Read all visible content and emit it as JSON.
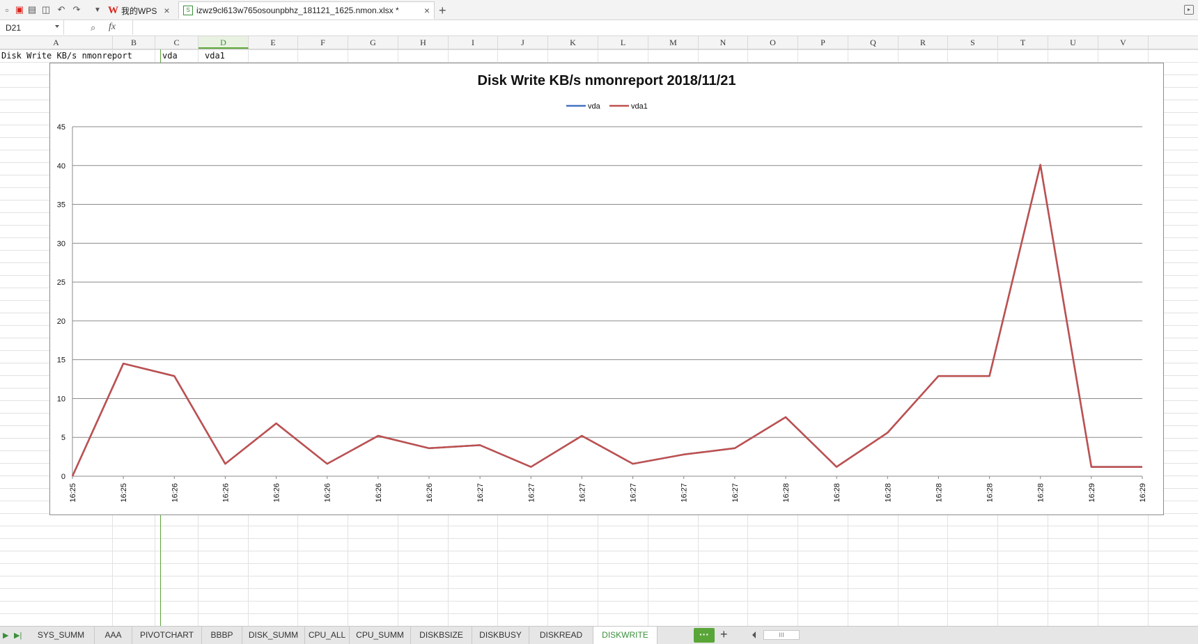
{
  "toolbar": {
    "wps_tab_label": "我的WPS",
    "file_tab_label": "izwz9cl613w765osounpbhz_181121_1625.nmon.xlsx *",
    "close_glyph": "×",
    "add_glyph": "+"
  },
  "formula_bar": {
    "name_box": "D21",
    "fx_label": "fx"
  },
  "columns": [
    "A",
    "B",
    "C",
    "D",
    "E",
    "F",
    "G",
    "H",
    "I",
    "J",
    "K",
    "L",
    "M",
    "N",
    "O",
    "P",
    "Q",
    "R",
    "S",
    "T",
    "U",
    "V"
  ],
  "selected_column": "D",
  "row1": {
    "a": "Disk Write KB/s nmonreport",
    "b": "vda",
    "c": "vda1"
  },
  "chart_data": {
    "type": "line",
    "title": "Disk Write KB/s nmonreport  2018/11/21",
    "xlabel": "",
    "ylabel": "",
    "ylim": [
      0,
      45
    ],
    "yticks": [
      0,
      5,
      10,
      15,
      20,
      25,
      30,
      35,
      40,
      45
    ],
    "legend_position": "top",
    "grid": true,
    "x": [
      "16:25",
      "16:25",
      "16:26",
      "16:26",
      "16:26",
      "16:26",
      "16:26",
      "16:26",
      "16:27",
      "16:27",
      "16:27",
      "16:27",
      "16:27",
      "16:27",
      "16:28",
      "16:28",
      "16:28",
      "16:28",
      "16:28",
      "16:28",
      "16:29",
      "16:29"
    ],
    "series": [
      {
        "name": "vda",
        "color": "#4472c4",
        "values": [
          0,
          14.5,
          12.9,
          1.6,
          6.8,
          1.6,
          5.2,
          3.6,
          4.0,
          1.2,
          5.2,
          1.6,
          2.8,
          3.6,
          7.6,
          1.2,
          5.6,
          12.9,
          12.9,
          40.1,
          1.2,
          1.2
        ]
      },
      {
        "name": "vda1",
        "color": "#c0504d",
        "values": [
          0,
          14.5,
          12.9,
          1.6,
          6.8,
          1.6,
          5.2,
          3.6,
          4.0,
          1.2,
          5.2,
          1.6,
          2.8,
          3.6,
          7.6,
          1.2,
          5.6,
          12.9,
          12.9,
          40.1,
          1.2,
          1.2
        ]
      }
    ]
  },
  "sheets": [
    "SYS_SUMM",
    "AAA",
    "PIVOTCHART",
    "BBBP",
    "DISK_SUMM",
    "CPU_ALL",
    "CPU_SUMM",
    "DISKBSIZE",
    "DISKBUSY",
    "DISKREAD",
    "DISKWRITE"
  ],
  "active_sheet": "DISKWRITE",
  "sheetbar": {
    "more_glyph": "···",
    "add_glyph": "+",
    "scroll_glyph": "III"
  }
}
